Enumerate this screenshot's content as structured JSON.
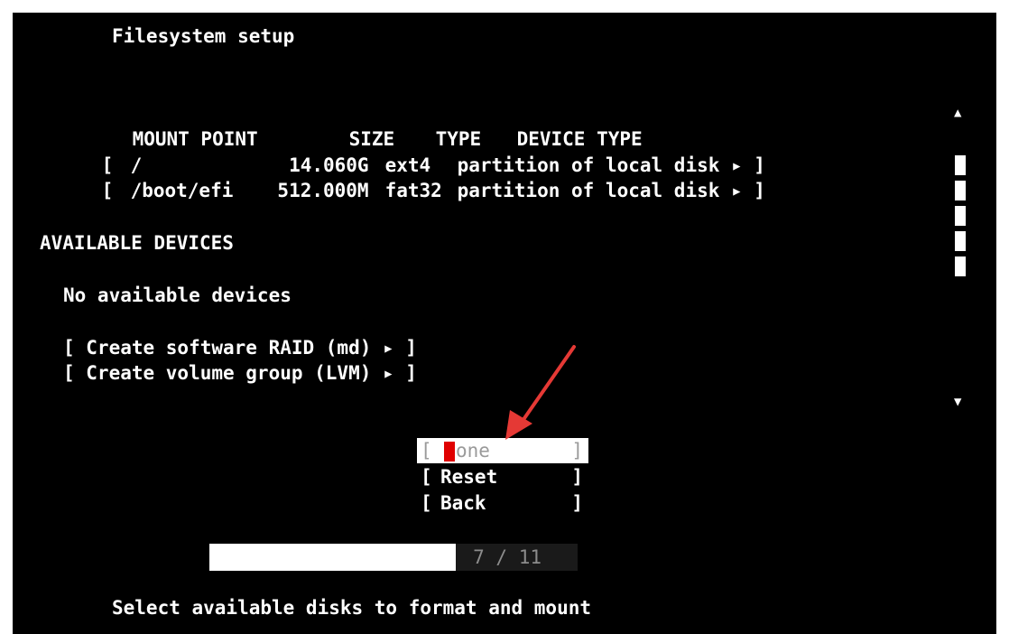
{
  "title": "Filesystem setup",
  "used_table": {
    "headers": {
      "mount_point": "MOUNT POINT",
      "size": "SIZE",
      "type": "TYPE",
      "device_type": "DEVICE TYPE"
    },
    "rows": [
      {
        "open": "[",
        "mount": "/",
        "size": "14.060G",
        "type": "ext4",
        "device": "partition of local disk ▸ ]"
      },
      {
        "open": "[",
        "mount": "/boot/efi",
        "size": "512.000M",
        "type": "fat32",
        "device": "partition of local disk ▸ ]"
      }
    ]
  },
  "available": {
    "heading": "AVAILABLE DEVICES",
    "empty_text": "No available devices",
    "actions": [
      "[ Create software RAID (md) ▸ ]",
      "[ Create volume group (LVM) ▸ ]"
    ]
  },
  "scrollbar": {
    "up": "▲",
    "down": "▼"
  },
  "buttons": {
    "done": "one",
    "reset": "Reset",
    "back": "Back",
    "open_bracket": "[",
    "close_bracket": "]"
  },
  "progress": {
    "label": "7 / 11",
    "current": 7,
    "total": 11,
    "fill_fraction": 0.67
  },
  "footer": {
    "hint": "Select available disks to format and mount"
  },
  "colors": {
    "terminal_bg": "#000000",
    "text": "#ffffff",
    "selected_text": "#9a9a9a",
    "cursor": "#e00000",
    "annotation_arrow": "#e53935"
  }
}
